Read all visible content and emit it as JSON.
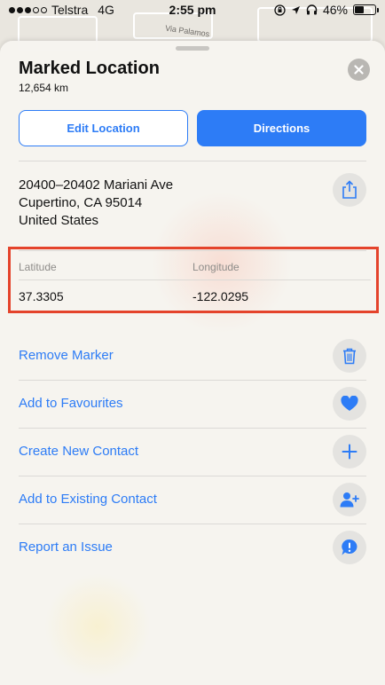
{
  "status_bar": {
    "carrier": "Telstra",
    "network": "4G",
    "time": "2:55 pm",
    "battery_percent": "46%",
    "battery_level": 0.46
  },
  "map": {
    "road_label": "Via Palamos"
  },
  "card": {
    "title": "Marked Location",
    "distance": "12,654 km",
    "edit_button": "Edit Location",
    "directions_button": "Directions",
    "address_lines": [
      "20400–20402 Mariani Ave",
      "Cupertino, CA  95014",
      "United States"
    ],
    "coordinates": {
      "latitude_label": "Latitude",
      "longitude_label": "Longitude",
      "latitude_value": "37.3305",
      "longitude_value": "-122.0295"
    },
    "actions": [
      {
        "label": "Remove Marker",
        "icon": "trash-icon"
      },
      {
        "label": "Add to Favourites",
        "icon": "heart-icon"
      },
      {
        "label": "Create New Contact",
        "icon": "plus-icon"
      },
      {
        "label": "Add to Existing Contact",
        "icon": "add-person-icon"
      },
      {
        "label": "Report an Issue",
        "icon": "report-icon"
      }
    ]
  },
  "colors": {
    "accent": "#2d7cf6",
    "highlight_border": "#e4432b"
  }
}
